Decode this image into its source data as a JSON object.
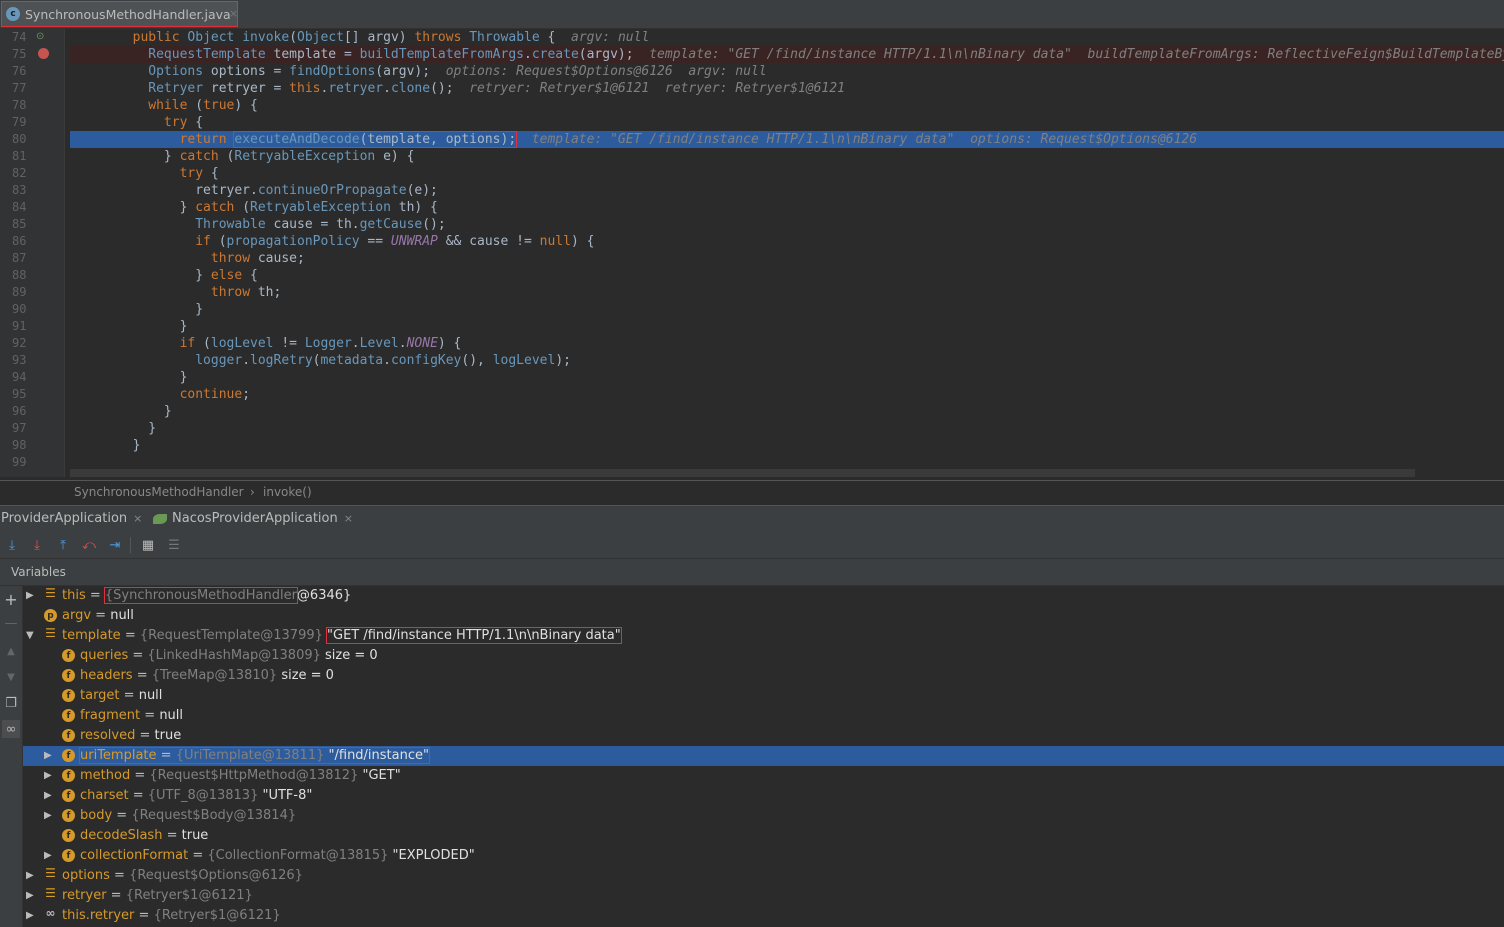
{
  "editor_tab": {
    "title": "SynchronousMethodHandler.java",
    "icon": "java-class-icon",
    "close": "×"
  },
  "code": [
    {
      "n": "74",
      "mark": "override-marker",
      "html": "<span class='k'>public</span> <span class='ty'>Object</span> <span class='fn'>invoke</span>(<span class='ty'>Object</span>[] argv) <span class='k'>throws</span> <span class='ty'>Throwable</span> {  <span class='cm'>argv: null</span>"
    },
    {
      "n": "75",
      "mark": "breakpoint",
      "html": "  <span class='ty'>RequestTemplate</span> template = <span class='fn'>buildTemplateFromArgs</span>.<span class='fn'>create</span>(argv);  <span class='cm'>template: \"GET /find/instance HTTP/1.1\\n\\nBinary data\"  buildTemplateFromArgs: ReflectiveFeign$BuildTemplateByRe</span>"
    },
    {
      "n": "76",
      "html": "  <span class='ty'>Options</span> options = <span class='fn'>findOptions</span>(argv);  <span class='cm'>options: Request$Options@6126  argv: null</span>"
    },
    {
      "n": "77",
      "html": "  <span class='ty'>Retryer</span> retryer = <span class='k'>this</span>.<span class='fn'>retryer</span>.<span class='fn'>clone</span>();  <span class='cm'>retryer: Retryer$1@6121  retryer: Retryer$1@6121</span>"
    },
    {
      "n": "78",
      "html": "  <span class='k'>while</span> (<span class='k'>true</span>) {"
    },
    {
      "n": "79",
      "html": "    <span class='k'>try</span> {"
    },
    {
      "n": "80",
      "html": "      <span class='k'>return</span> <span class='redbox'><span class='fn'>executeAndDecode</span>(template, options);</span>  <span class='cm'>template: \"GET /find/instance HTTP/1.1\\n\\nBinary data\"  options: Request$Options@6126</span>"
    },
    {
      "n": "81",
      "html": "    } <span class='k'>catch</span> (<span class='ty'>RetryableException</span> e) {"
    },
    {
      "n": "82",
      "html": "      <span class='k'>try</span> {"
    },
    {
      "n": "83",
      "html": "        retryer.<span class='fn'>continueOrPropagate</span>(e);"
    },
    {
      "n": "84",
      "html": "      } <span class='k'>catch</span> (<span class='ty'>RetryableException</span> th) {"
    },
    {
      "n": "85",
      "html": "        <span class='ty'>Throwable</span> cause = th.<span class='fn'>getCause</span>();"
    },
    {
      "n": "86",
      "html": "        <span class='k'>if</span> (<span class='fn'>propagationPolicy</span> == <span class='cst'>UNWRAP</span> &amp;&amp; cause != <span class='k'>null</span>) {"
    },
    {
      "n": "87",
      "html": "          <span class='k'>throw</span> cause;"
    },
    {
      "n": "88",
      "html": "        } <span class='k'>else</span> {"
    },
    {
      "n": "89",
      "html": "          <span class='k'>throw</span> th;"
    },
    {
      "n": "90",
      "html": "        }"
    },
    {
      "n": "91",
      "html": "      }"
    },
    {
      "n": "92",
      "html": "      <span class='k'>if</span> (<span class='fn'>logLevel</span> != <span class='ty'>Logger</span>.<span class='ty'>Level</span>.<span class='cst'>NONE</span>) {"
    },
    {
      "n": "93",
      "html": "        <span class='fn'>logger</span>.<span class='fn'>logRetry</span>(<span class='fn'>metadata</span>.<span class='fn'>configKey</span>(), <span class='fn'>logLevel</span>);"
    },
    {
      "n": "94",
      "html": "      }"
    },
    {
      "n": "95",
      "html": "      <span class='k'>continue</span>;"
    },
    {
      "n": "96",
      "html": "    }"
    },
    {
      "n": "97",
      "html": "  }"
    },
    {
      "n": "98",
      "html": "}"
    },
    {
      "n": "99",
      "html": ""
    }
  ],
  "breadcrumb": {
    "class_name": "SynchronousMethodHandler",
    "sep": "›",
    "method": "invoke()"
  },
  "run_tabs": [
    {
      "label": "ProviderApplication",
      "close": "×"
    },
    {
      "label": "NacosProviderApplication",
      "close": "×"
    }
  ],
  "toolbar_icons": [
    "step-over-icon",
    "step-into-icon",
    "step-out-icon",
    "drop-frame-icon",
    "run-to-cursor-icon",
    "evaluate-icon",
    "trace-icon"
  ],
  "variables_title": "Variables",
  "left_icons": [
    "add-watch-icon",
    "remove-watch-icon",
    "up-icon",
    "down-icon",
    "copy-icon",
    "glasses-icon"
  ],
  "variables": [
    {
      "arrow": "▶",
      "indent": 0,
      "icon": "stack",
      "name": "this",
      "eq": " = ",
      "type": "{SynchronousMethodHandler",
      "val": "@6346}",
      "boxed": "type"
    },
    {
      "arrow": "",
      "indent": 0,
      "icon": "p",
      "name": "argv",
      "eq": " = ",
      "type": "",
      "val": "null"
    },
    {
      "arrow": "▼",
      "indent": 0,
      "icon": "stack",
      "name": "template",
      "eq": " = ",
      "type": "{RequestTemplate@13799} ",
      "val": "\"GET /find/instance HTTP/1.1\\n\\nBinary data\"",
      "boxed": "val"
    },
    {
      "arrow": "",
      "indent": 1,
      "icon": "f",
      "name": "queries",
      "eq": " = ",
      "type": "{LinkedHashMap@13809} ",
      "val": " size = 0"
    },
    {
      "arrow": "",
      "indent": 1,
      "icon": "f",
      "name": "headers",
      "eq": " = ",
      "type": "{TreeMap@13810} ",
      "val": " size = 0"
    },
    {
      "arrow": "",
      "indent": 1,
      "icon": "f",
      "name": "target",
      "eq": " = ",
      "type": "",
      "val": "null"
    },
    {
      "arrow": "",
      "indent": 1,
      "icon": "f",
      "name": "fragment",
      "eq": " = ",
      "type": "",
      "val": "null"
    },
    {
      "arrow": "",
      "indent": 1,
      "icon": "f",
      "name": "resolved",
      "eq": " = ",
      "type": "",
      "val": "true"
    },
    {
      "arrow": "▶",
      "indent": 1,
      "icon": "f",
      "name": "uriTemplate",
      "eq": " = ",
      "type": "{UriTemplate@13811} ",
      "val": "\"/find/instance\"",
      "selected": true,
      "boxed": "all"
    },
    {
      "arrow": "▶",
      "indent": 1,
      "icon": "f",
      "name": "method",
      "eq": " = ",
      "type": "{Request$HttpMethod@13812} ",
      "val": "\"GET\""
    },
    {
      "arrow": "▶",
      "indent": 1,
      "icon": "f",
      "name": "charset",
      "eq": " = ",
      "type": "{UTF_8@13813} ",
      "val": "\"UTF-8\""
    },
    {
      "arrow": "▶",
      "indent": 1,
      "icon": "f",
      "name": "body",
      "eq": " = ",
      "type": "{Request$Body@13814}",
      "val": ""
    },
    {
      "arrow": "",
      "indent": 1,
      "icon": "f",
      "name": "decodeSlash",
      "eq": " = ",
      "type": "",
      "val": "true"
    },
    {
      "arrow": "▶",
      "indent": 1,
      "icon": "f",
      "name": "collectionFormat",
      "eq": " = ",
      "type": "{CollectionFormat@13815} ",
      "val": "\"EXPLODED\""
    },
    {
      "arrow": "▶",
      "indent": 0,
      "icon": "stack",
      "name": "options",
      "eq": " = ",
      "type": "{Request$Options@6126}",
      "val": ""
    },
    {
      "arrow": "▶",
      "indent": 0,
      "icon": "stack",
      "name": "retryer",
      "eq": " = ",
      "type": "{Retryer$1@6121}",
      "val": ""
    },
    {
      "arrow": "▶",
      "indent": 0,
      "icon": "glass",
      "name": "this.retryer",
      "eq": " = ",
      "type": "{Retryer$1@6121}",
      "val": ""
    }
  ]
}
